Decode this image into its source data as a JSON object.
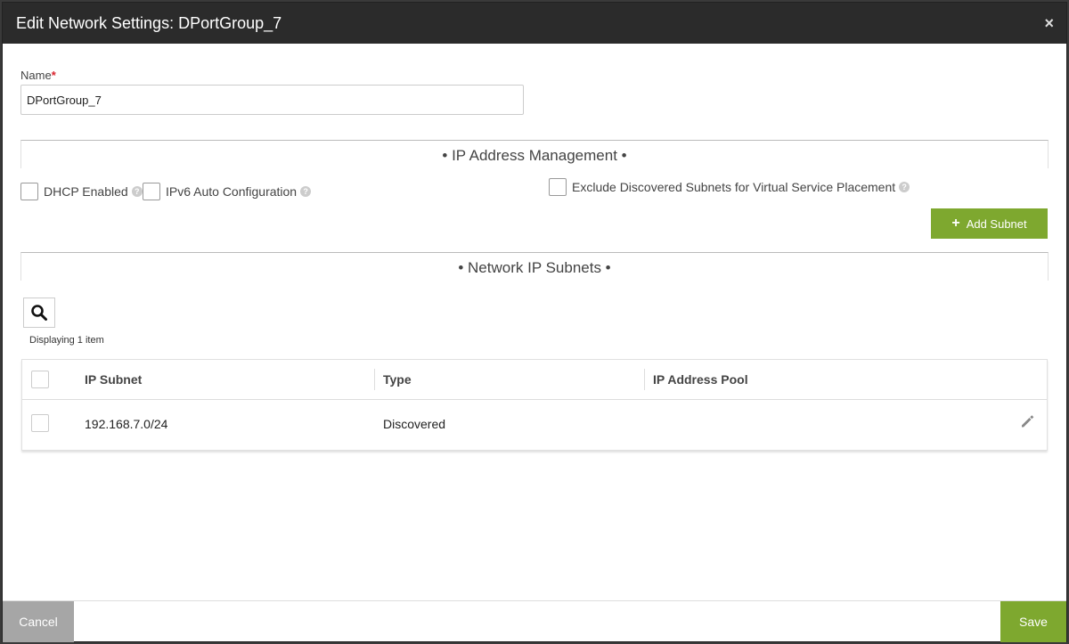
{
  "dialog": {
    "title": "Edit Network Settings: DPortGroup_7",
    "close_icon": "×"
  },
  "name_field": {
    "label": "Name",
    "required_mark": "*",
    "value": "DPortGroup_7"
  },
  "ipam": {
    "section_title": "• IP Address Management •",
    "dhcp_label": "DHCP Enabled",
    "ipv6_label": "IPv6 Auto Configuration",
    "exclude_label": "Exclude Discovered Subnets for Virtual Service Placement",
    "add_subnet_label": "Add Subnet"
  },
  "subnets": {
    "section_title": "• Network IP Subnets •",
    "displaying": "Displaying 1 item",
    "columns": [
      "IP Subnet",
      "Type",
      "IP Address Pool"
    ],
    "rows": [
      {
        "ip_subnet": "192.168.7.0/24",
        "type": "Discovered",
        "ip_address_pool": ""
      }
    ]
  },
  "footer": {
    "cancel_label": "Cancel",
    "save_label": "Save"
  },
  "colors": {
    "accent": "#7ea82f",
    "header_bg": "#2b2b2b",
    "cancel_bg": "#a6a6a6",
    "required": "#d9232d"
  }
}
